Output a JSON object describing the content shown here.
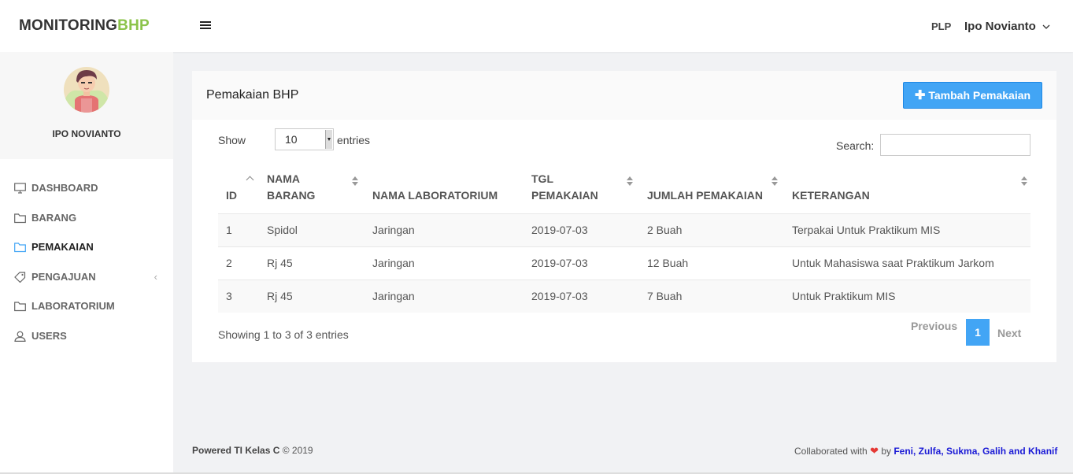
{
  "brand": {
    "part1": "MONITORING",
    "part2": "BHP"
  },
  "header": {
    "role": "PLP",
    "user": "Ipo Novianto"
  },
  "sidebar": {
    "profile_name": "IPO NOVIANTO",
    "items": [
      {
        "label": "DASHBOARD",
        "icon": "monitor-icon"
      },
      {
        "label": "BARANG",
        "icon": "folder-icon"
      },
      {
        "label": "PEMAKAIAN",
        "icon": "folder-icon",
        "active": true
      },
      {
        "label": "PENGAJUAN",
        "icon": "tag-icon"
      },
      {
        "label": "LABORATORIUM",
        "icon": "folder-icon"
      },
      {
        "label": "USERS",
        "icon": "user-icon"
      }
    ]
  },
  "panel": {
    "title": "Pemakaian BHP",
    "add_button": "Tambah Pemakaian",
    "show_label": "Show",
    "entries_value": "10",
    "entries_label": "entries",
    "search_label": "Search:",
    "search_value": ""
  },
  "table": {
    "headers": [
      "ID",
      "NAMA BARANG",
      "NAMA LABORATORIUM",
      "TGL PEMAKAIAN",
      "JUMLAH PEMAKAIAN",
      "KETERANGAN"
    ],
    "rows": [
      [
        "1",
        "Spidol",
        "Jaringan",
        "2019-07-03",
        "2 Buah",
        "Terpakai Untuk Praktikum MIS"
      ],
      [
        "2",
        "Rj 45",
        "Jaringan",
        "2019-07-03",
        "12 Buah",
        "Untuk Mahasiswa saat Praktikum Jarkom"
      ],
      [
        "3",
        "Rj 45",
        "Jaringan",
        "2019-07-03",
        "7 Buah",
        "Untuk Praktikum MIS"
      ]
    ]
  },
  "pagination": {
    "info": "Showing 1 to 3 of 3 entries",
    "previous": "Previous",
    "current": "1",
    "next": "Next"
  },
  "footer": {
    "powered": "Powered TI Kelas C",
    "copyright": "© 2019",
    "collab": "Collaborated with",
    "by": "by",
    "authors": "Feni, Zulfa, Sukma, Galih and Khanif"
  },
  "colors": {
    "accent": "#42a5f5",
    "brand_green": "#8bc34a",
    "heart": "#e53935",
    "link": "#1a1ad6"
  }
}
